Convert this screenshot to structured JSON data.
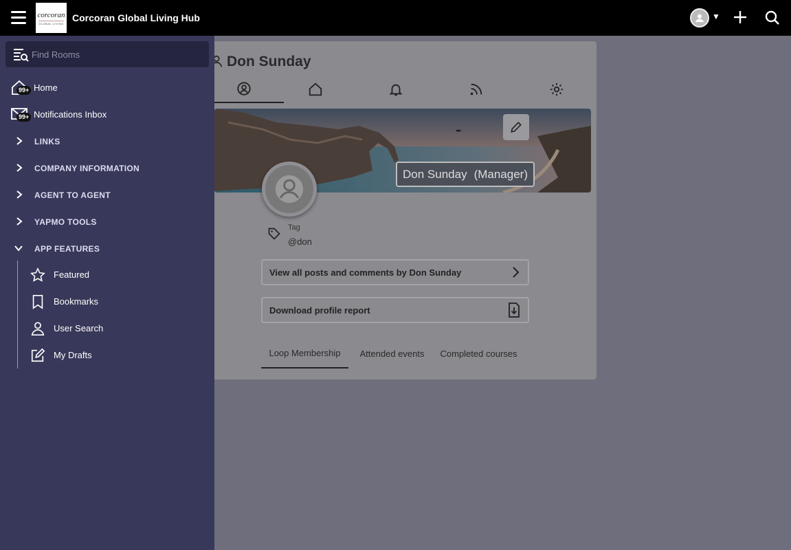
{
  "app": {
    "title": "Corcoran Global Living Hub",
    "logo_text": "corcoran",
    "logo_subtext": "GLOBAL LIVING"
  },
  "sidebar": {
    "search_placeholder": "Find Rooms",
    "items": [
      {
        "label": "Home",
        "badge": "99+",
        "icon": "home-icon"
      },
      {
        "label": "Notifications Inbox",
        "badge": "99+",
        "icon": "mail-icon"
      }
    ],
    "sections": [
      {
        "label": "LINKS",
        "expanded": false
      },
      {
        "label": "COMPANY INFORMATION",
        "expanded": false
      },
      {
        "label": "AGENT TO AGENT",
        "expanded": false
      },
      {
        "label": "YAPMO TOOLS",
        "expanded": false
      },
      {
        "label": "APP FEATURES",
        "expanded": true
      }
    ],
    "app_features": [
      {
        "label": "Featured",
        "icon": "star-icon"
      },
      {
        "label": "Bookmarks",
        "icon": "bookmark-icon"
      },
      {
        "label": "User Search",
        "icon": "user-icon"
      },
      {
        "label": "My Drafts",
        "icon": "drafts-icon"
      }
    ]
  },
  "profile": {
    "name": "Don Sunday",
    "role": "(Manager)",
    "tag_label": "Tag",
    "tag_value": "@don",
    "view_posts_label": "View all posts and comments by Don Sunday",
    "download_report_label": "Download profile report",
    "tabs": [
      {
        "icon": "profile-icon",
        "active": true
      },
      {
        "icon": "home-icon",
        "active": false
      },
      {
        "icon": "bell-icon",
        "active": false
      },
      {
        "icon": "rss-icon",
        "active": false
      },
      {
        "icon": "gear-icon",
        "active": false
      }
    ],
    "sub_tabs": [
      {
        "label": "Loop Membership",
        "active": true
      },
      {
        "label": "Attended events",
        "active": false
      },
      {
        "label": "Completed courses",
        "active": false
      }
    ]
  },
  "colors": {
    "topbar": "#000000",
    "sidebar": "#38385a",
    "overlay": "#6e6e7c"
  }
}
